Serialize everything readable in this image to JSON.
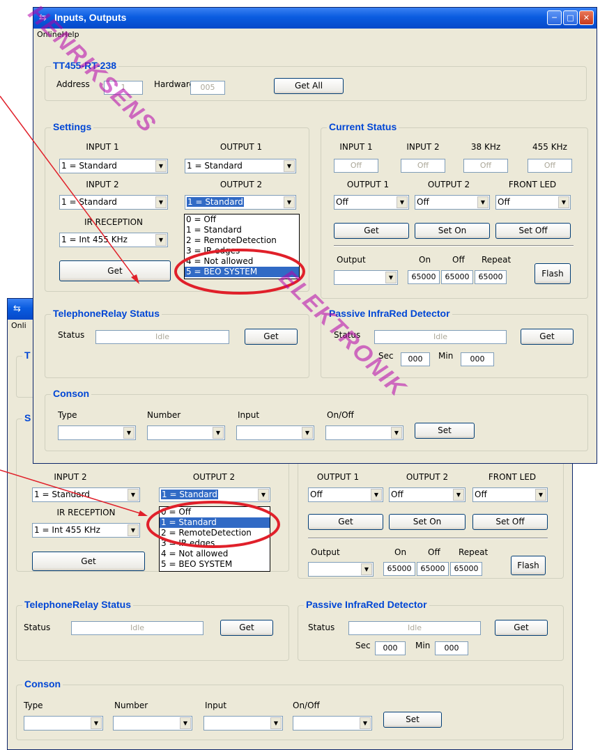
{
  "window": {
    "title": "Inputs, Outputs",
    "menu": "OnlineHelp",
    "device_group": "TT455-RT-238",
    "address_label": "Address",
    "address_value": "1",
    "hardware_label": "Hardware",
    "hardware_value": "005",
    "get_all": "Get All"
  },
  "back_window": {
    "menu_partial": "Onli",
    "group_partial_1": "T",
    "group_partial_2": "S"
  },
  "settings": {
    "title": "Settings",
    "input1_label": "INPUT 1",
    "output1_label": "OUTPUT 1",
    "input2_label": "INPUT 2",
    "output2_label": "OUTPUT 2",
    "ir_label": "IR RECEPTION",
    "input1_value": "1 = Standard",
    "output1_value": "1 = Standard",
    "input2_value": "1 = Standard",
    "output2_value": "1 = Standard",
    "ir_value": "1 = Int 455 KHz",
    "get": "Get",
    "output2_options": [
      "0 = Off",
      "1 = Standard",
      "2 = RemoteDetection",
      "3 = IR edges",
      "4 = Not allowed",
      "5 = BEO SYSTEM"
    ]
  },
  "current_status": {
    "title": "Current Status",
    "input1_label": "INPUT 1",
    "input2_label": "INPUT 2",
    "khz38_label": "38 KHz",
    "khz455_label": "455 KHz",
    "input1_value": "Off",
    "input2_value": "Off",
    "khz38_value": "Off",
    "khz455_value": "Off",
    "output1_label": "OUTPUT 1",
    "output2_label": "OUTPUT 2",
    "front_led_label": "FRONT LED",
    "output1_value": "Off",
    "output2_value": "Off",
    "front_led_value": "Off",
    "get": "Get",
    "set_on": "Set On",
    "set_off": "Set Off",
    "output_label": "Output",
    "on_label": "On",
    "off_label": "Off",
    "repeat_label": "Repeat",
    "on_value": "65000",
    "off_value": "65000",
    "repeat_value": "65000",
    "flash": "Flash"
  },
  "telephone": {
    "title": "TelephoneRelay Status",
    "status_label": "Status",
    "status_value": "Idle",
    "get": "Get"
  },
  "pir": {
    "title": "Passive InfraRed Detector",
    "status_label": "Status",
    "status_value": "Idle",
    "get": "Get",
    "sec_label": "Sec",
    "sec_value": "000",
    "min_label": "Min",
    "min_value": "000"
  },
  "conson": {
    "title": "Conson",
    "type_label": "Type",
    "number_label": "Number",
    "input_label": "Input",
    "onoff_label": "On/Off",
    "set": "Set"
  },
  "watermark": [
    "HENRIKSENS",
    "ELEKTRONIK"
  ],
  "colors": {
    "group_title": "#0046d5",
    "selection": "#316ac5",
    "annotation": "#e0202a",
    "watermark": "#b400aa"
  }
}
